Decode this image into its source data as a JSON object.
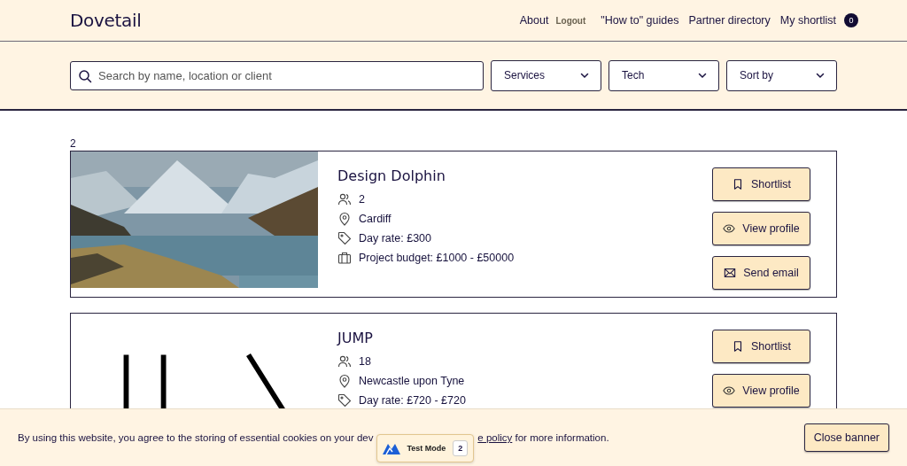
{
  "header": {
    "logo": "Dovetail",
    "nav": [
      {
        "label": "About",
        "kind": "link"
      },
      {
        "label": "Logout",
        "kind": "small"
      },
      {
        "label": "\"How to\" guides",
        "kind": "link"
      },
      {
        "label": "Partner directory",
        "kind": "link"
      },
      {
        "label": "My shortlist",
        "kind": "link",
        "count": "0"
      }
    ]
  },
  "filters": {
    "search": {
      "placeholder": "Search by name, location or client"
    },
    "dropdowns": [
      {
        "label": "Services"
      },
      {
        "label": "Tech"
      },
      {
        "label": "Sort by"
      }
    ]
  },
  "results_count": "2",
  "partners": [
    {
      "name": "Design Dolphin",
      "image": {
        "kind": "picture"
      },
      "details": [
        {
          "kind": "team",
          "text": "2"
        },
        {
          "kind": "location",
          "text": "Cardiff"
        },
        {
          "kind": "rate",
          "text": "Day rate: £300"
        },
        {
          "kind": "budget",
          "text": "Project budget: £1000 - £50000"
        }
      ],
      "actions": [
        {
          "kind": "shortlist",
          "label": "Shortlist"
        },
        {
          "kind": "view",
          "label": "View profile"
        },
        {
          "kind": "email",
          "label": "Send email"
        }
      ]
    },
    {
      "name": "JUMP",
      "image": {
        "kind": "picture"
      },
      "details": [
        {
          "kind": "team",
          "text": "18"
        },
        {
          "kind": "location",
          "text": "Newcastle upon Tyne"
        },
        {
          "kind": "rate",
          "text": "Day rate: £720 - £720"
        }
      ],
      "actions": [
        {
          "kind": "shortlist",
          "label": "Shortlist"
        },
        {
          "kind": "view",
          "label": "View profile"
        }
      ]
    }
  ],
  "cookie_banner": {
    "text_before": "By using this website, you agree to the storing of essential cookies on your dev",
    "link": "e policy",
    "text_after": "for more information.",
    "button": "Close banner"
  },
  "test_mode_badge": {
    "label": "Test Mode",
    "count": "2"
  }
}
